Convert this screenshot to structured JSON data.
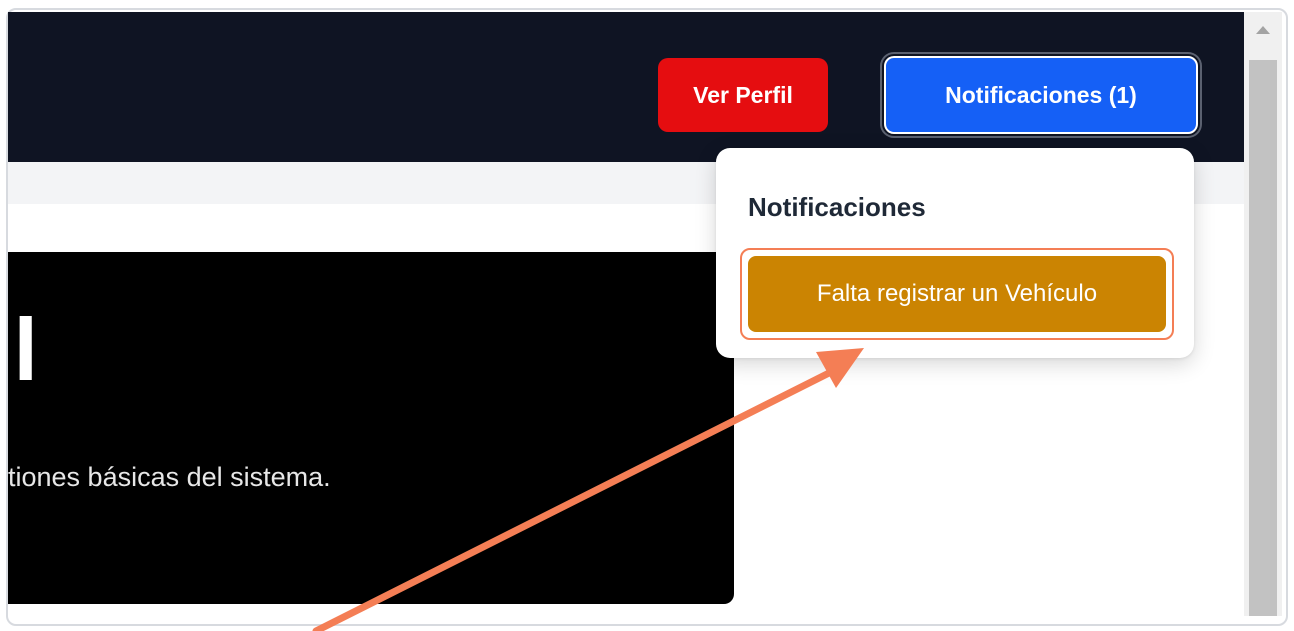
{
  "header": {
    "profile_button": "Ver Perfil",
    "notifications_button": "Notificaciones (1)"
  },
  "notifications_panel": {
    "title": "Notificaciones",
    "items": [
      {
        "label": "Falta registrar un Vehículo"
      }
    ]
  },
  "hero": {
    "title": "l",
    "description": "tiones básicas del sistema."
  },
  "colors": {
    "nav_background": "#0f1423",
    "profile_button": "#e50d10",
    "notifications_button": "#1560f6",
    "notification_item": "#cb8402",
    "annotation_arrow": "#f47e55"
  },
  "icons": {
    "scroll_up": "scroll-up-arrow-icon",
    "annotation": "annotation-arrow-icon"
  }
}
